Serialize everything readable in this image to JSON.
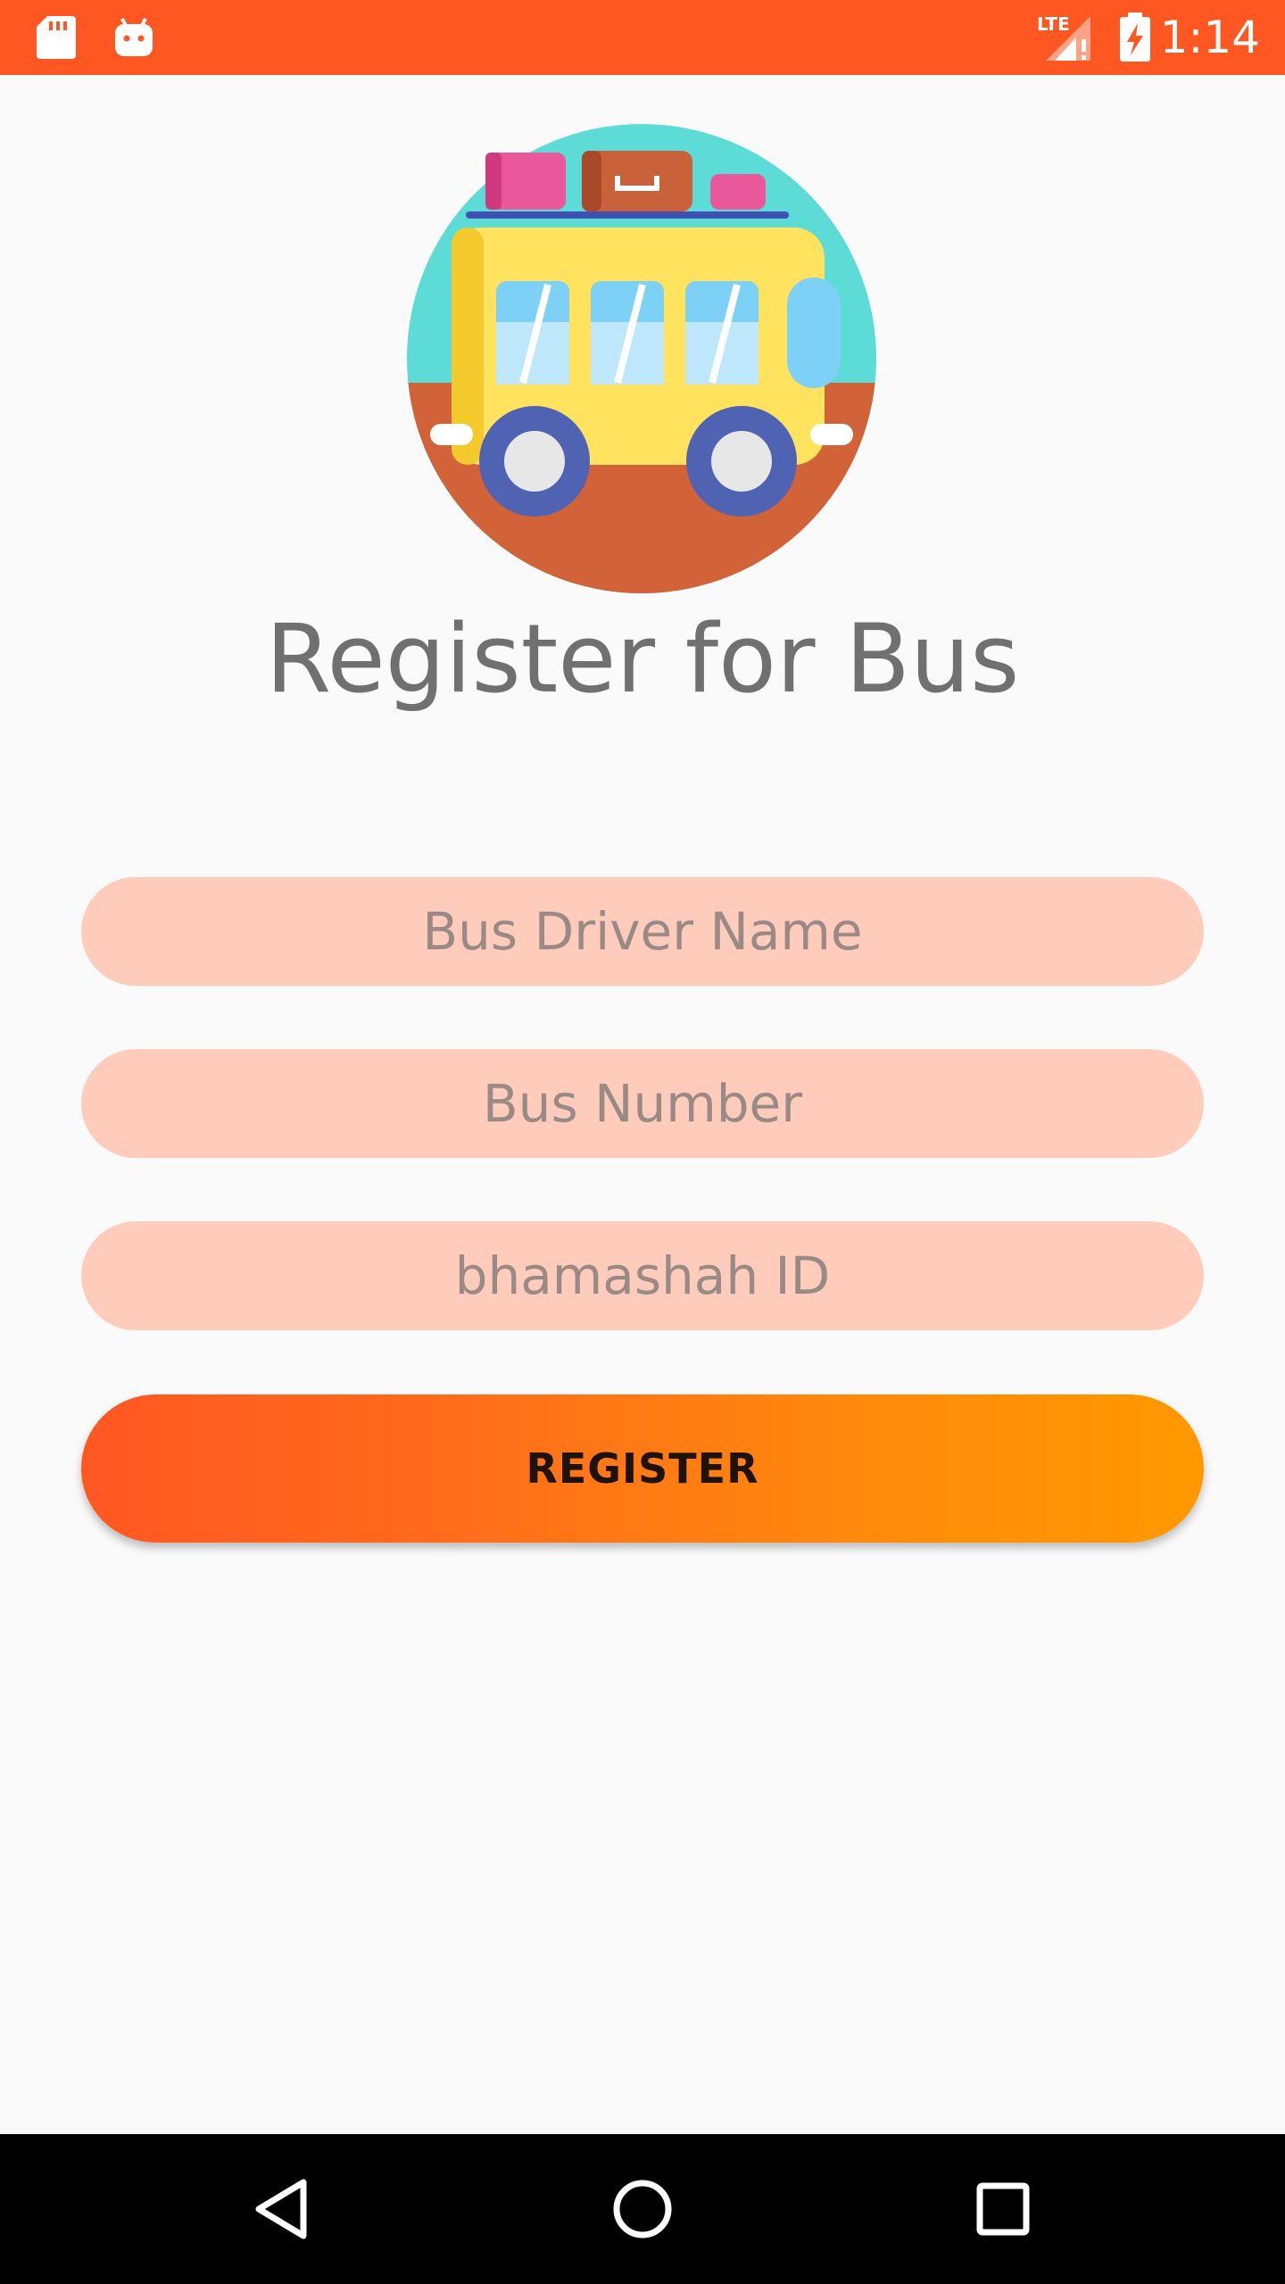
{
  "status_bar": {
    "time": "1:14",
    "icons": [
      "sd-card-icon",
      "android-icon",
      "lte-signal-icon",
      "battery-charging-icon"
    ],
    "background": "#ff5722",
    "network_label": "LTE"
  },
  "header": {
    "logo": "bus-logo-icon",
    "title": "Register for Bus"
  },
  "form": {
    "driver_name": {
      "value": "",
      "placeholder": "Bus Driver Name"
    },
    "bus_number": {
      "value": "",
      "placeholder": "Bus Number"
    },
    "bhamashah_id": {
      "value": "",
      "placeholder": "bhamashah ID"
    },
    "field_color": "#ffccbc",
    "register_label": "REGISTER",
    "button_gradient": [
      "#ff5722",
      "#ff9800"
    ]
  },
  "nav_bar": {
    "buttons": [
      "back-icon",
      "home-icon",
      "recents-icon"
    ]
  }
}
